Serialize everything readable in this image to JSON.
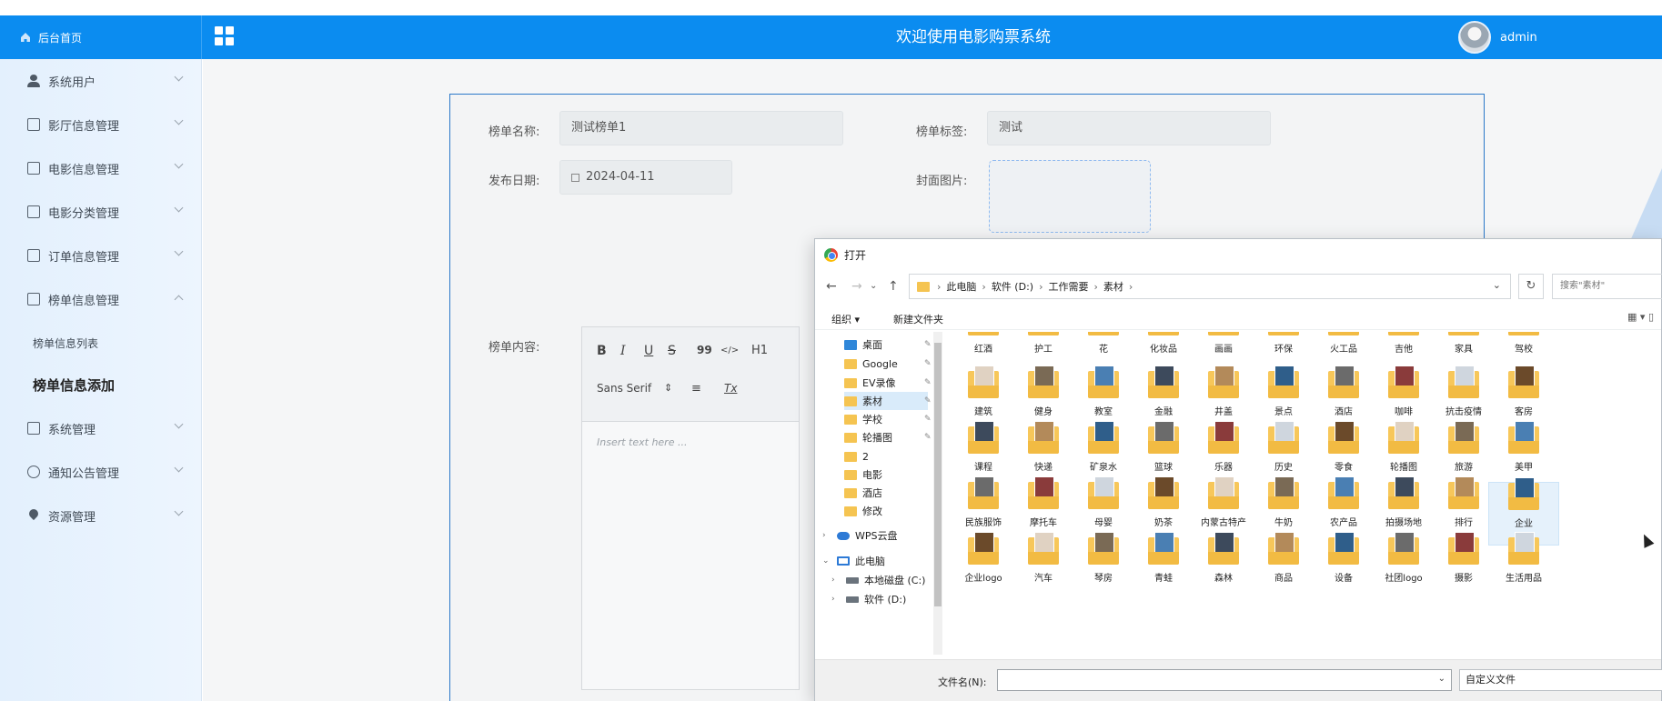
{
  "header": {
    "home_label": "后台首页",
    "title": "欢迎使用电影购票系统",
    "username": "admin"
  },
  "sidebar": {
    "items": [
      {
        "label": "系统用户"
      },
      {
        "label": "影厅信息管理"
      },
      {
        "label": "电影信息管理"
      },
      {
        "label": "电影分类管理"
      },
      {
        "label": "订单信息管理"
      },
      {
        "label": "榜单信息管理"
      },
      {
        "label": "系统管理"
      },
      {
        "label": "通知公告管理"
      },
      {
        "label": "资源管理"
      }
    ],
    "sub_items": [
      {
        "label": "榜单信息列表"
      },
      {
        "label": "榜单信息添加"
      }
    ]
  },
  "form": {
    "name_label": "榜单名称:",
    "name_value": "测试榜单1",
    "tag_label": "榜单标签:",
    "tag_value": "测试",
    "date_label": "发布日期:",
    "date_value": "2024-04-11",
    "cover_label": "封面图片:",
    "content_label": "榜单内容:",
    "editor": {
      "bold": "B",
      "italic": "I",
      "underline": "U",
      "strike": "S",
      "quote": "99",
      "code": "</>",
      "heading": "H1",
      "font": "Sans Serif",
      "font_arrow": "⇕",
      "clear": "Tx",
      "placeholder": "Insert text here ..."
    }
  },
  "dialog": {
    "title": "打开",
    "path": [
      "此电脑",
      "软件 (D:)",
      "工作需要",
      "素材"
    ],
    "search_placeholder": "搜索\"素材\"",
    "organize": "组织 ▾",
    "new_folder": "新建文件夹",
    "nav": [
      {
        "label": "桌面"
      },
      {
        "label": "Google"
      },
      {
        "label": "EV录像"
      },
      {
        "label": "素材"
      },
      {
        "label": "学校"
      },
      {
        "label": "轮播图"
      },
      {
        "label": "2"
      },
      {
        "label": "电影"
      },
      {
        "label": "酒店"
      },
      {
        "label": "修改"
      }
    ],
    "nav_groups": [
      {
        "label": "WPS云盘"
      },
      {
        "label": "此电脑"
      },
      {
        "label": "本地磁盘 (C:)"
      },
      {
        "label": "软件 (D:)"
      }
    ],
    "files": [
      [
        "红酒",
        "护工",
        "花",
        "化妆品",
        "画画",
        "环保",
        "火工品",
        "吉他",
        "家具",
        "驾校"
      ],
      [
        "建筑",
        "健身",
        "教室",
        "金融",
        "井盖",
        "景点",
        "酒店",
        "咖啡",
        "抗击疫情",
        "客房"
      ],
      [
        "课程",
        "快递",
        "矿泉水",
        "篮球",
        "乐器",
        "历史",
        "零食",
        "轮播图",
        "旅游",
        "美甲"
      ],
      [
        "民族服饰",
        "摩托车",
        "母婴",
        "奶茶",
        "内蒙古特产",
        "牛奶",
        "农产品",
        "拍摄场地",
        "排行",
        "企业"
      ],
      [
        "企业logo",
        "汽车",
        "琴房",
        "青蛙",
        "森林",
        "商品",
        "设备",
        "社团logo",
        "摄影",
        "生活用品"
      ]
    ],
    "filename_label": "文件名(N):",
    "filetype": "自定义文件"
  }
}
